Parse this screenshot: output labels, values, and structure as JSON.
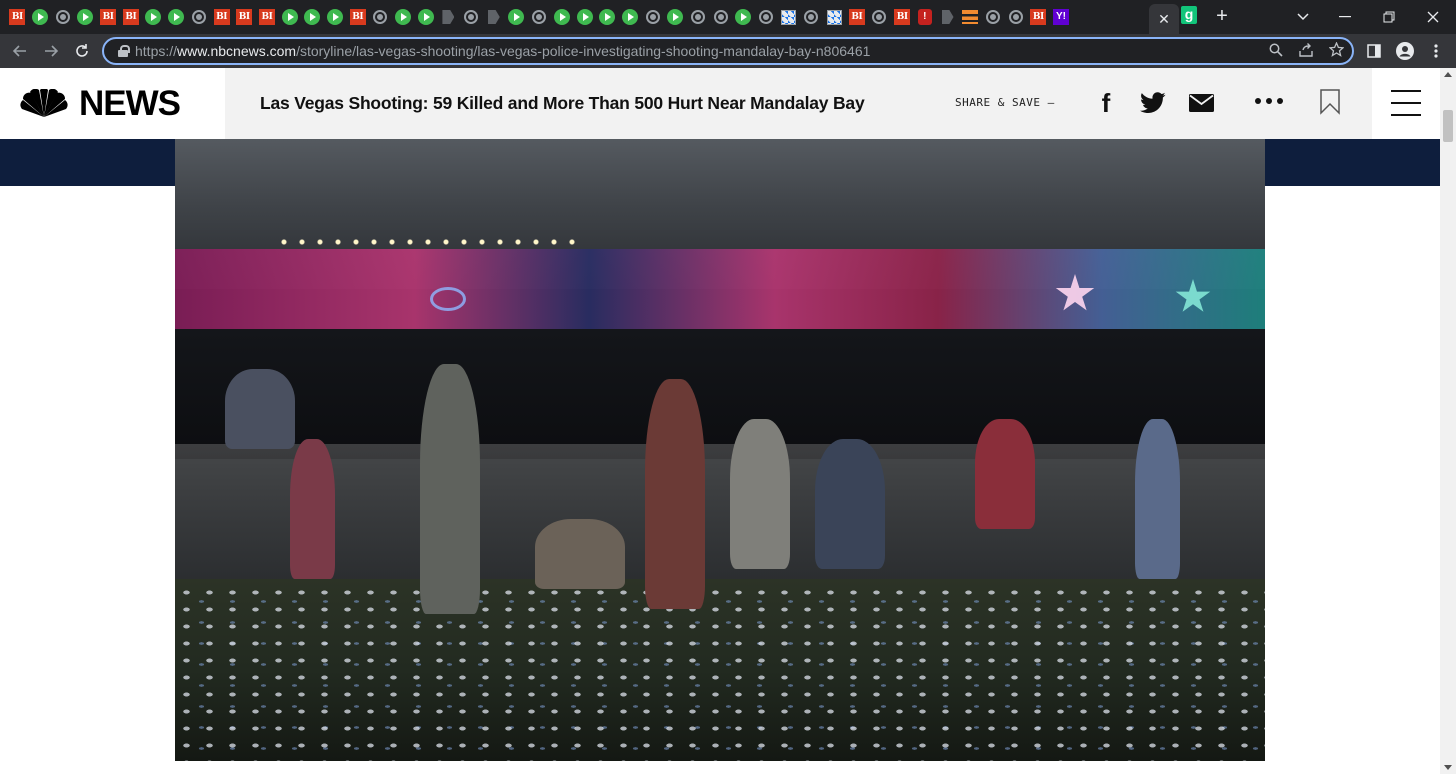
{
  "browser": {
    "tabs": [
      {
        "icon": "bi-favicon",
        "label": "BI"
      },
      {
        "icon": "play-favicon"
      },
      {
        "icon": "globe-favicon"
      },
      {
        "icon": "play-favicon"
      },
      {
        "icon": "bi-favicon",
        "label": "BI"
      },
      {
        "icon": "bi-favicon",
        "label": "BI"
      },
      {
        "icon": "play-favicon"
      },
      {
        "icon": "play-favicon"
      },
      {
        "icon": "globe-favicon"
      },
      {
        "icon": "bi-favicon",
        "label": "BI"
      },
      {
        "icon": "bi-favicon",
        "label": "BI"
      },
      {
        "icon": "bi-favicon",
        "label": "BI"
      },
      {
        "icon": "play-favicon"
      },
      {
        "icon": "play-favicon"
      },
      {
        "icon": "play-favicon"
      },
      {
        "icon": "bi-favicon",
        "label": "BI"
      },
      {
        "icon": "globe-favicon"
      },
      {
        "icon": "play-favicon"
      },
      {
        "icon": "play-favicon"
      },
      {
        "icon": "doc-favicon"
      },
      {
        "icon": "globe-favicon"
      },
      {
        "icon": "doc-favicon"
      },
      {
        "icon": "play-favicon"
      },
      {
        "icon": "globe-favicon"
      },
      {
        "icon": "play-favicon"
      },
      {
        "icon": "play-favicon"
      },
      {
        "icon": "play-favicon"
      },
      {
        "icon": "play-favicon"
      },
      {
        "icon": "globe-favicon"
      },
      {
        "icon": "play-favicon"
      },
      {
        "icon": "globe-favicon"
      },
      {
        "icon": "globe-favicon"
      },
      {
        "icon": "play-favicon"
      },
      {
        "icon": "globe-favicon"
      },
      {
        "icon": "tile-favicon"
      },
      {
        "icon": "globe-favicon"
      },
      {
        "icon": "tile-favicon"
      },
      {
        "icon": "bi-favicon",
        "label": "BI"
      },
      {
        "icon": "globe-favicon"
      },
      {
        "icon": "bi-favicon",
        "label": "BI"
      },
      {
        "icon": "red-favicon",
        "label": "!"
      },
      {
        "icon": "doc-favicon"
      },
      {
        "icon": "orange-favicon"
      },
      {
        "icon": "globe-favicon"
      },
      {
        "icon": "globe-favicon"
      },
      {
        "icon": "bi-favicon",
        "label": "BI"
      },
      {
        "icon": "yahoo-favicon",
        "label": "Y!"
      }
    ],
    "active_tab_close": "✕",
    "last_tab_label": "g",
    "new_tab": "+",
    "url_prefix": "https://",
    "url_host": "www.nbcnews.com",
    "url_path": "/storyline/las-vegas-shooting/las-vegas-police-investigating-shooting-mandalay-bay-n806461"
  },
  "site": {
    "logo_text": "NEWS",
    "headline": "Las Vegas Shooting: 59 Killed and More Than 500 Hurt Near Mandalay Bay",
    "share_label": "SHARE & SAVE —",
    "facebook_glyph": "f"
  },
  "colors": {
    "chrome_dark": "#202124",
    "toolbar": "#35363a",
    "focus_ring": "#8ab4f8",
    "header_bg": "#f2f2f2",
    "navy_band": "#0e1e3d"
  }
}
